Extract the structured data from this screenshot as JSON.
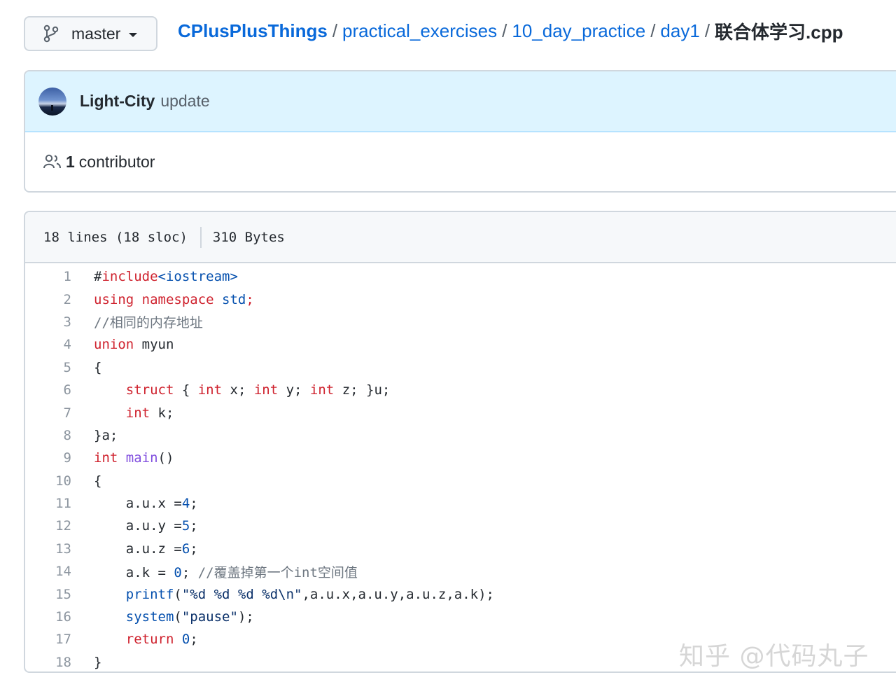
{
  "branch": {
    "label": "master",
    "icon": "git-branch-icon"
  },
  "breadcrumb": {
    "repo": "CPlusPlusThings",
    "dirs": [
      "practical_exercises",
      "10_day_practice",
      "day1"
    ],
    "file": "联合体学习.cpp",
    "separator": "/"
  },
  "commit": {
    "author": "Light-City",
    "message": "update"
  },
  "contributors": {
    "count": "1",
    "label": "contributor",
    "icon": "people-icon"
  },
  "file_info": {
    "lines": "18 lines (18 sloc)",
    "size": "310 Bytes"
  },
  "code": {
    "lines": [
      {
        "n": "1",
        "tokens": [
          [
            "p",
            "#"
          ],
          [
            "k",
            "include"
          ],
          [
            "e",
            "<iostream>"
          ]
        ]
      },
      {
        "n": "2",
        "tokens": [
          [
            "k",
            "using namespace "
          ],
          [
            "e",
            "std"
          ],
          [
            "k",
            ";"
          ]
        ]
      },
      {
        "n": "3",
        "tokens": [
          [
            "c",
            "//相同的内存地址"
          ]
        ]
      },
      {
        "n": "4",
        "tokens": [
          [
            "k",
            "union"
          ],
          [
            "p",
            " myun"
          ]
        ]
      },
      {
        "n": "5",
        "tokens": [
          [
            "p",
            "{"
          ]
        ]
      },
      {
        "n": "6",
        "tokens": [
          [
            "p",
            "    "
          ],
          [
            "k",
            "struct"
          ],
          [
            "p",
            " { "
          ],
          [
            "k",
            "int"
          ],
          [
            "p",
            " x; "
          ],
          [
            "k",
            "int"
          ],
          [
            "p",
            " y; "
          ],
          [
            "k",
            "int"
          ],
          [
            "p",
            " z; }u;"
          ]
        ]
      },
      {
        "n": "7",
        "tokens": [
          [
            "p",
            "    "
          ],
          [
            "k",
            "int"
          ],
          [
            "p",
            " k;"
          ]
        ]
      },
      {
        "n": "8",
        "tokens": [
          [
            "p",
            "}a;"
          ]
        ]
      },
      {
        "n": "9",
        "tokens": [
          [
            "k",
            "int"
          ],
          [
            "p",
            " "
          ],
          [
            "f",
            "main"
          ],
          [
            "p",
            "()"
          ]
        ]
      },
      {
        "n": "10",
        "tokens": [
          [
            "p",
            "{"
          ]
        ]
      },
      {
        "n": "11",
        "tokens": [
          [
            "p",
            "    a.u.x ="
          ],
          [
            "e",
            "4"
          ],
          [
            "p",
            ";"
          ]
        ]
      },
      {
        "n": "12",
        "tokens": [
          [
            "p",
            "    a.u.y ="
          ],
          [
            "e",
            "5"
          ],
          [
            "p",
            ";"
          ]
        ]
      },
      {
        "n": "13",
        "tokens": [
          [
            "p",
            "    a.u.z ="
          ],
          [
            "e",
            "6"
          ],
          [
            "p",
            ";"
          ]
        ]
      },
      {
        "n": "14",
        "tokens": [
          [
            "p",
            "    a.k = "
          ],
          [
            "e",
            "0"
          ],
          [
            "p",
            "; "
          ],
          [
            "c",
            "//覆盖掉第一个int空间值"
          ]
        ]
      },
      {
        "n": "15",
        "tokens": [
          [
            "p",
            "    "
          ],
          [
            "e",
            "printf"
          ],
          [
            "p",
            "("
          ],
          [
            "s",
            "\"%d %d %d %d\\n\""
          ],
          [
            "p",
            ",a.u.x,a.u.y,a.u.z,a.k);"
          ]
        ]
      },
      {
        "n": "16",
        "tokens": [
          [
            "p",
            "    "
          ],
          [
            "e",
            "system"
          ],
          [
            "p",
            "("
          ],
          [
            "s",
            "\"pause\""
          ],
          [
            "p",
            ");"
          ]
        ]
      },
      {
        "n": "17",
        "tokens": [
          [
            "p",
            "    "
          ],
          [
            "k",
            "return"
          ],
          [
            "p",
            " "
          ],
          [
            "e",
            "0"
          ],
          [
            "p",
            ";"
          ]
        ]
      },
      {
        "n": "18",
        "tokens": [
          [
            "p",
            "}"
          ]
        ]
      }
    ]
  },
  "watermark": "知乎 @代码丸子",
  "colors": {
    "link": "#0969da",
    "keyword": "#cf222e",
    "entity": "#0550ae",
    "function": "#8250df",
    "comment": "#6e7781",
    "commit_bg": "#ddf4ff"
  }
}
